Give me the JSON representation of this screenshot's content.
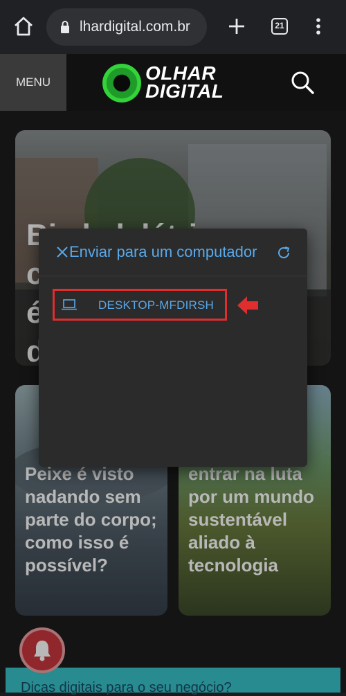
{
  "browser": {
    "url": "lhardigital.com.br",
    "tab_count": "21"
  },
  "site": {
    "menu_label": "MENU",
    "logo_line1": "OLHAR",
    "logo_line2": "DIGITAL"
  },
  "cards": [
    {
      "headline": "Bi   k  l  létri\nc\né                   s\nd"
    },
    {
      "headline": "Peixe é visto nadando sem parte do corpo; como isso é possível?"
    },
    {
      "headline": "entrar na luta por um mundo sustentável aliado à tecnologia"
    }
  ],
  "banner": {
    "text": "Dicas digitais para o seu negócio?"
  },
  "dialog": {
    "title": "Enviar para um computador",
    "device_name": "DESKTOP-MFDIRSH"
  },
  "colors": {
    "accent": "#5aa9ea",
    "highlight": "#e02d2d",
    "banner": "#36c1c7"
  }
}
